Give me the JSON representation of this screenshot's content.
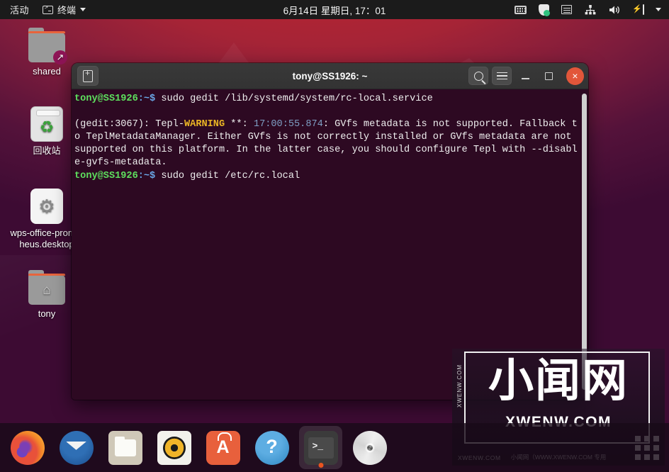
{
  "topbar": {
    "activities": "活动",
    "app_menu": {
      "label": "终端",
      "icon": "terminal-icon",
      "caret": "chevron-down-icon"
    },
    "clock": "6月14日 星期日, 17：01",
    "tray": [
      {
        "name": "keyboard-indicator-icon"
      },
      {
        "name": "shield-security-icon"
      },
      {
        "name": "input-method-icon"
      },
      {
        "name": "network-icon"
      },
      {
        "name": "volume-icon"
      },
      {
        "name": "battery-icon"
      },
      {
        "name": "chevron-down-icon"
      }
    ]
  },
  "desktop_icons": [
    {
      "label": "shared",
      "icon": "folder-shared-link-icon",
      "badge": "↗"
    },
    {
      "label": "回收站",
      "icon": "trash-icon",
      "symbol": "♻"
    },
    {
      "label": "wps-office-prometheus.desktop",
      "icon": "gear-application-icon",
      "symbol": "⚙"
    },
    {
      "label": "tony",
      "icon": "folder-home-icon",
      "symbol": "⌂"
    }
  ],
  "terminal": {
    "title": "tony@SS1926: ~",
    "buttons": {
      "new_tab": "new-tab-button",
      "search": "search-button",
      "menu": "hamburger-menu-button",
      "minimize": "minimize-button",
      "maximize": "maximize-button",
      "close": "×"
    },
    "lines": [
      {
        "type": "prompt",
        "user": "tony@SS1926",
        "path": ":~$",
        "command": " sudo gedit /lib/systemd/system/rc-local.service"
      },
      {
        "type": "blank",
        "text": ""
      },
      {
        "type": "warning",
        "pre": "(gedit:3067): Tepl-",
        "level": "WARNING",
        "mid": " **: ",
        "time": "17:00:55.874",
        "post": ": GVfs metadata is not supported. Fallback to TeplMetadataManager. Either GVfs is not correctly installed or GVfs metadata are not supported on this platform. In the latter case, you should configure Tepl with --disable-gvfs-metadata."
      },
      {
        "type": "prompt",
        "user": "tony@SS1926",
        "path": ":~$",
        "command": " sudo gedit /etc/rc.local"
      }
    ],
    "colors": {
      "background": "#2d0922",
      "foreground": "#eeeeee",
      "user": "#5ee05e",
      "path": "#6aa8e8",
      "warning": "#e9b424",
      "timestamp": "#7e9fc4"
    }
  },
  "watermark": {
    "cn": "小闻网",
    "en": "XWENW.COM",
    "side": "XWENW.COM",
    "bottom_left": "XWENW.COM",
    "bottom_center": "小闻网（WWW.XWENW.COM 专用"
  },
  "dock": [
    {
      "name": "dock-item-firefox",
      "icon": "firefox-icon",
      "active": false
    },
    {
      "name": "dock-item-thunderbird",
      "icon": "thunderbird-icon",
      "active": false
    },
    {
      "name": "dock-item-files",
      "icon": "files-folder-icon",
      "active": false
    },
    {
      "name": "dock-item-rhythmbox",
      "icon": "rhythmbox-icon",
      "active": false
    },
    {
      "name": "dock-item-ubuntu-software",
      "icon": "ubuntu-software-icon",
      "active": false
    },
    {
      "name": "dock-item-help",
      "icon": "help-question-icon",
      "active": false
    },
    {
      "name": "dock-item-terminal",
      "icon": "terminal-icon",
      "active": true,
      "prompt": ">_"
    },
    {
      "name": "dock-item-disc",
      "icon": "optical-disc-icon",
      "active": false
    }
  ]
}
